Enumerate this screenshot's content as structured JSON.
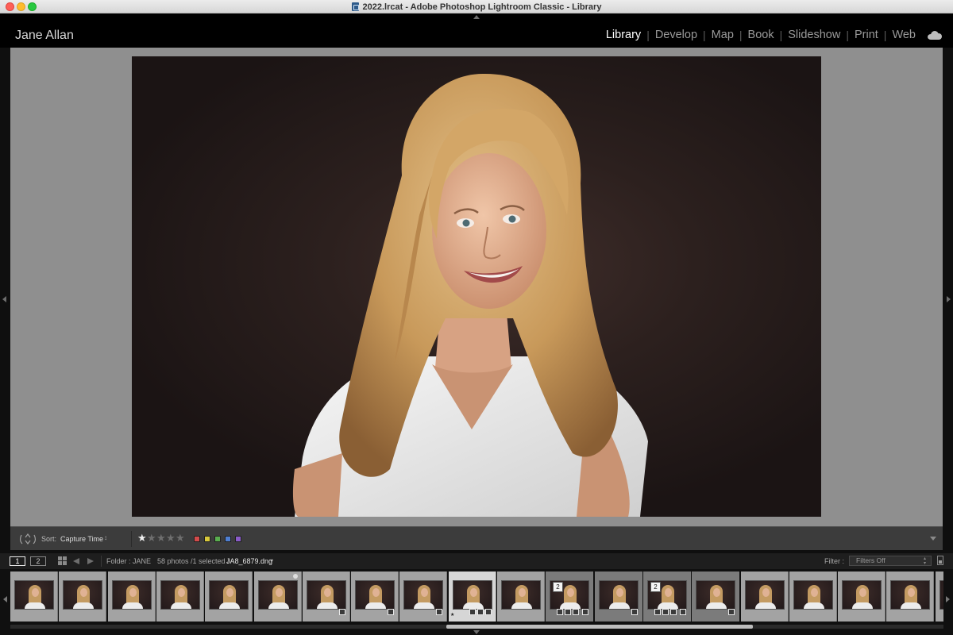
{
  "window": {
    "title": "2022.lrcat - Adobe Photoshop Lightroom Classic - Library"
  },
  "identity_plate": "Jane Allan",
  "modules": [
    {
      "label": "Library",
      "active": true
    },
    {
      "label": "Develop",
      "active": false
    },
    {
      "label": "Map",
      "active": false
    },
    {
      "label": "Book",
      "active": false
    },
    {
      "label": "Slideshow",
      "active": false
    },
    {
      "label": "Print",
      "active": false
    },
    {
      "label": "Web",
      "active": false
    }
  ],
  "icons": {
    "cloud": "cloud-icon",
    "sort": "sort-direction-icon",
    "grid": "grid-view-icon"
  },
  "toolbar": {
    "sort_label": "Sort:",
    "sort_value": "Capture Time",
    "rating": 1,
    "rating_max": 5,
    "color_labels": [
      "#d34b4b",
      "#d8c93b",
      "#5aae4f",
      "#4f7fd1",
      "#8a5cc9"
    ]
  },
  "filmstrip_header": {
    "view_primary": "1",
    "view_secondary": "2",
    "folder": "Folder : JANE",
    "count": "58 photos /1 selected /",
    "file": "JA8_6879.dng",
    "filter_label": "Filter :",
    "filter_value": "Filters Off"
  },
  "filmstrip": {
    "selected_index": 9,
    "cells": [
      {
        "state": "normal"
      },
      {
        "state": "normal"
      },
      {
        "state": "normal"
      },
      {
        "state": "normal"
      },
      {
        "state": "normal"
      },
      {
        "state": "normal",
        "dot": true
      },
      {
        "state": "normal",
        "edited": true
      },
      {
        "state": "normal",
        "edited": true
      },
      {
        "state": "normal",
        "edited": true
      },
      {
        "state": "selected",
        "edited": true
      },
      {
        "state": "normal"
      },
      {
        "state": "dim",
        "stack": "2",
        "edited": true
      },
      {
        "state": "dim",
        "edited": true
      },
      {
        "state": "dim",
        "stack": "2",
        "edited": true
      },
      {
        "state": "dim",
        "edited": true
      },
      {
        "state": "normal"
      },
      {
        "state": "normal"
      },
      {
        "state": "normal"
      },
      {
        "state": "normal"
      },
      {
        "state": "normal"
      }
    ]
  }
}
